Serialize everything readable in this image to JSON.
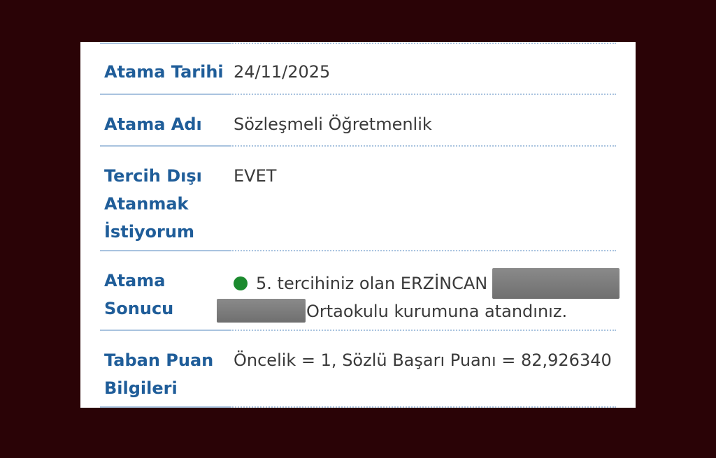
{
  "rows": [
    {
      "label": "Atama Tarihi",
      "value": "24/11/2025"
    },
    {
      "label": "Atama Adı",
      "value": "Sözleşmeli Öğretmenlik"
    },
    {
      "label_lines": [
        "Tercih Dışı",
        "Atanmak",
        "İstiyorum"
      ],
      "value": "EVET"
    },
    {
      "label_lines": [
        "Atama",
        "Sonucu"
      ],
      "value_line1": "5. tercihiniz olan ERZİNCAN",
      "value_line2": "Ortaokulu kurumuna atandınız.",
      "status_color": "#1b8a2e"
    },
    {
      "label_lines": [
        "Taban Puan",
        "Bilgileri"
      ],
      "value": "Öncelik = 1, Sözlü Başarı Puanı = 82,926340"
    }
  ],
  "colors": {
    "label": "#1f5d99",
    "value": "#3a3a3a",
    "background": "#2a0306",
    "card": "#ffffff",
    "separator": "#a9c3df",
    "redaction": "#7a7a7a"
  }
}
